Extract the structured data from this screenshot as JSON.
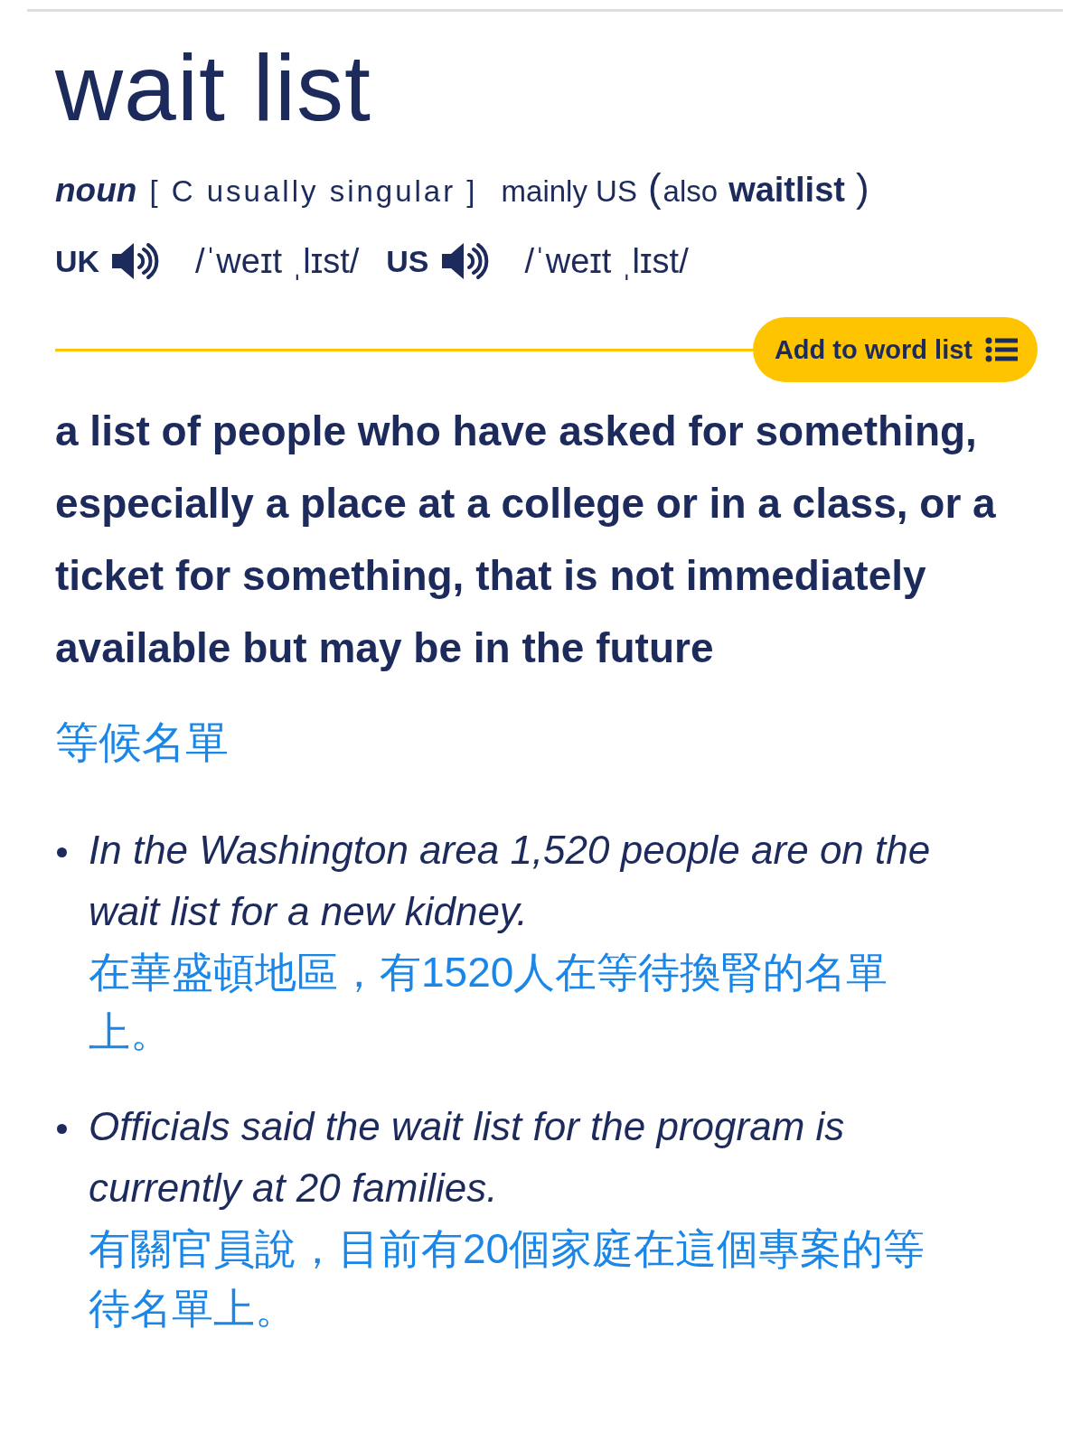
{
  "headword": "wait list",
  "grammar": {
    "pos": "noun",
    "code": "[ C usually singular ]",
    "region": "mainly US",
    "variant": {
      "open": "(",
      "label": "also",
      "word": "waitlist",
      "close": ")"
    }
  },
  "pronunciations": [
    {
      "region": "UK",
      "ipa": "/ˈweɪt ˌlɪst/"
    },
    {
      "region": "US",
      "ipa": "/ˈweɪt ˌlɪst/"
    }
  ],
  "add_button": "Add to word list",
  "definition": "a list of people who have asked for something, especially a place at a college or in a class, or a ticket for something, that is not immediately available but may be in the future",
  "translation": "等候名單",
  "examples": [
    {
      "text": "In the Washington area 1,520 people are on the wait list for a new kidney.",
      "translation": "在華盛頓地區，有1520人在等待換腎的名單上。"
    },
    {
      "text": "Officials said the wait list for the program is currently at 20 families.",
      "translation": "有關官員說，目前有20個家庭在這個專案的等待名單上。"
    }
  ]
}
